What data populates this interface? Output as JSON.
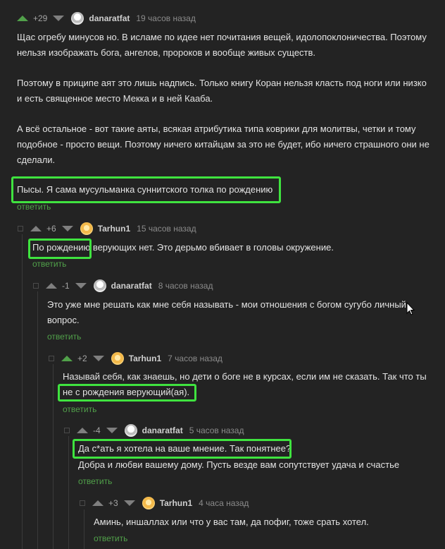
{
  "comments": [
    {
      "rating": "+29",
      "nick": "danaratfat",
      "time": "19 часов назад",
      "paragraphs": [
        "Щас огребу минусов но. В исламе по идее нет почитания вещей, идолопоклоничества. Поэтому нельзя изображать бога, ангелов, пророков и вообще живых существ.",
        "Поэтому в приципе аят это лишь надпись. Только книгу Коран нельзя класть под ноги или низко и есть священное место Мекка и в ней Кааба.",
        "А всё остальное - вот такие аяты, всякая атрибутика типа коврики для молитвы, четки и тому подобное - просто вещи. Поэтому ничего китайцам за это не будет, ибо ничего страшного они не сделали.",
        "Пысы. Я сама мусульманка суннитского толка по рождению"
      ],
      "reply": "ответить"
    },
    {
      "rating": "+6",
      "nick": "Tarhun1",
      "time": "15 часов назад",
      "paragraphs": [
        "По рождению верующих нет. Это дерьмо вбивает в головы окружение."
      ],
      "reply": "ответить"
    },
    {
      "rating": "-1",
      "nick": "danaratfat",
      "time": "8 часов назад",
      "paragraphs": [
        "Это уже мне решать как мне себя называть -  мои отношения с богом сугубо личный вопрос."
      ],
      "reply": "ответить"
    },
    {
      "rating": "+2",
      "nick": "Tarhun1",
      "time": "7 часов назад",
      "paragraphs": [
        "Называй себя, как знаешь, но дети о боге не в курсах, если им не сказать. Так что ты не с рождения верующий(ая)."
      ],
      "reply": "ответить"
    },
    {
      "rating": "-4",
      "nick": "danaratfat",
      "time": "5 часов назад",
      "paragraphs": [
        "Да с*ать я хотела на ваше мнение. Так понятнее?",
        "Добра и любви вашему дому. Пусть везде вам сопутствует удача и счастье"
      ],
      "reply": "ответить"
    },
    {
      "rating": "+3",
      "nick": "Tarhun1",
      "time": "4 часа назад",
      "paragraphs": [
        "Аминь, иншаллах или что у вас там, да пофиг, тоже срать хотел."
      ],
      "reply": "ответить"
    }
  ]
}
